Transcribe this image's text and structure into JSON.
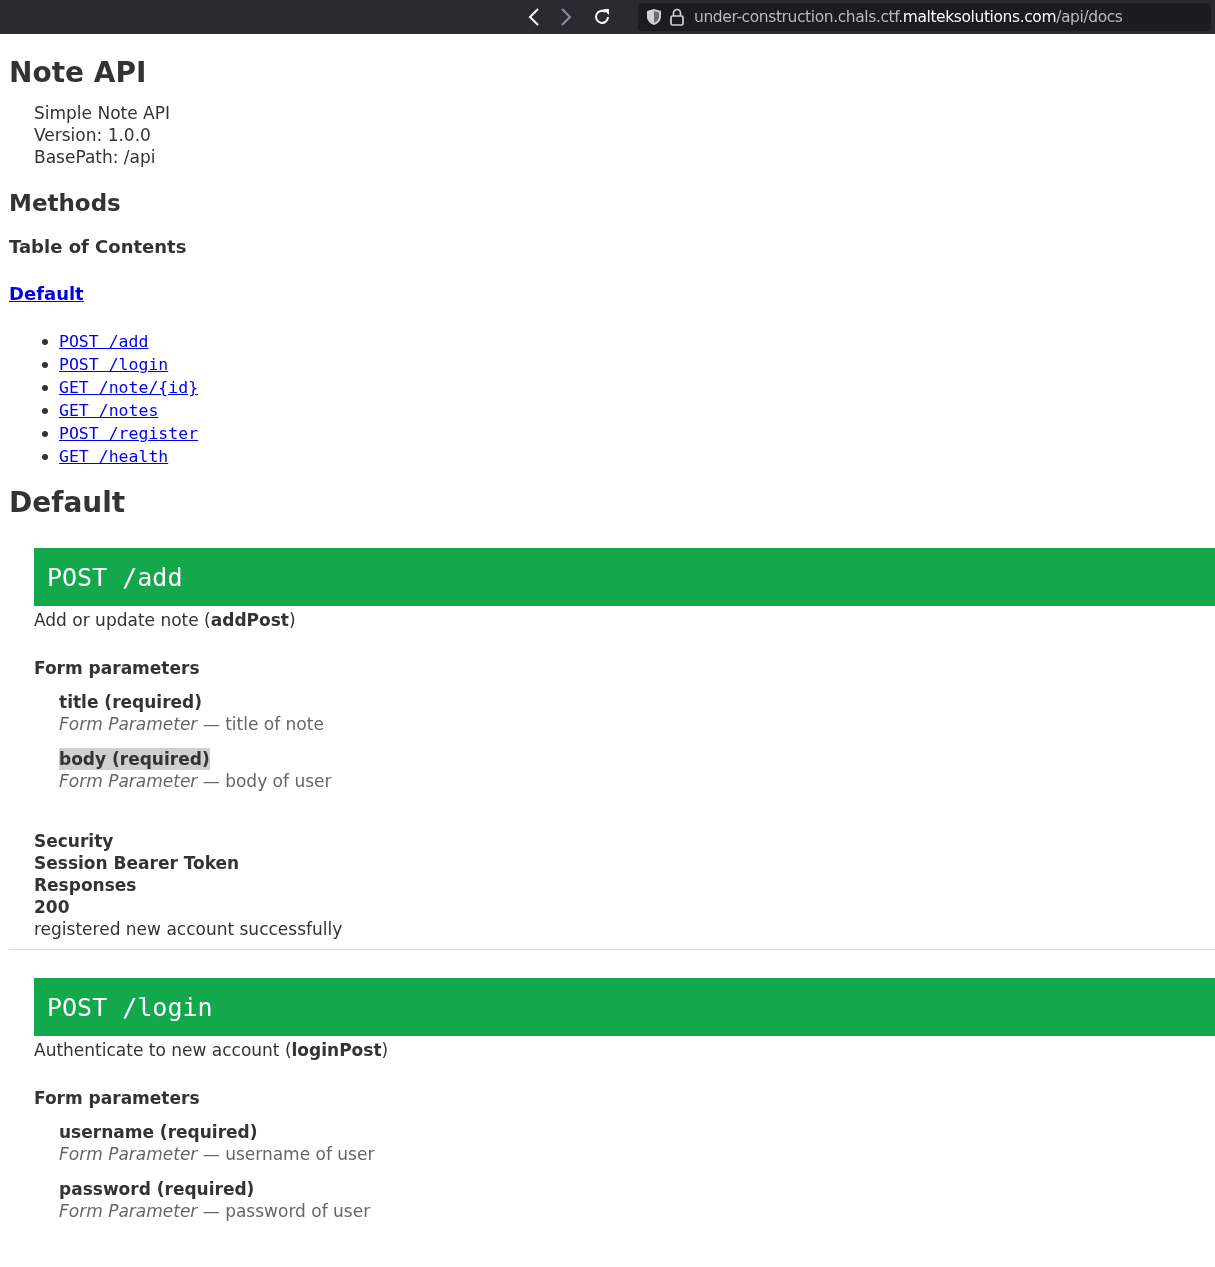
{
  "browser": {
    "url": "under-construction.chals.ctf.**malteksolutions.com**/api/docs"
  },
  "title": "Note API",
  "info": [
    "Simple Note API",
    "Version: 1.0.0",
    "BasePath: /api"
  ],
  "methods_heading": "Methods",
  "toc_heading": "Table of Contents",
  "toc_group": "Default",
  "toc_links": [
    "POST /add",
    "POST /login",
    "GET /note/{id}",
    "GET /notes",
    "POST /register",
    "GET /health"
  ],
  "section_heading": "Default",
  "endpoints": [
    {
      "label": "POST /add",
      "summary": "Add or update note (**addPost**)",
      "params_heading": "Form parameters",
      "params": [
        {
          "name": "title (required)",
          "desc": "*Form Parameter* — title of note",
          "highlighted": false
        },
        {
          "name": "body (required)",
          "desc": "*Form Parameter* — body of user",
          "highlighted": true
        }
      ],
      "security_heading": "Security",
      "security": "Session Bearer Token",
      "responses_heading": "Responses",
      "code": "200",
      "response": "registered new account successfully"
    },
    {
      "label": "POST /login",
      "summary": "Authenticate to new account (**loginPost**)",
      "params_heading": "Form parameters",
      "params": [
        {
          "name": "username (required)",
          "desc": "*Form Parameter* — username of user",
          "highlighted": false
        },
        {
          "name": "password (required)",
          "desc": "*Form Parameter* — password of user",
          "highlighted": false
        }
      ]
    }
  ]
}
